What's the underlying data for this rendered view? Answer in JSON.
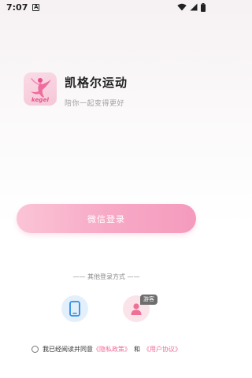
{
  "status_bar": {
    "time": "7:07",
    "notification_letter": "A"
  },
  "app": {
    "title": "凯格尔运动",
    "slogan": "陪你一起变得更好",
    "logo_text": "kegel",
    "brand_color": "#f59bbd"
  },
  "login": {
    "wechat_label": "微信登录",
    "other_methods_label": "—— 其他登录方式 ——",
    "guest_badge": "游客"
  },
  "agreement": {
    "prefix": "我已经阅读并同意",
    "privacy_link": "《隐私政策》",
    "and": "和",
    "user_agreement_link": "《用户协议》",
    "link_color": "#f26a97"
  }
}
